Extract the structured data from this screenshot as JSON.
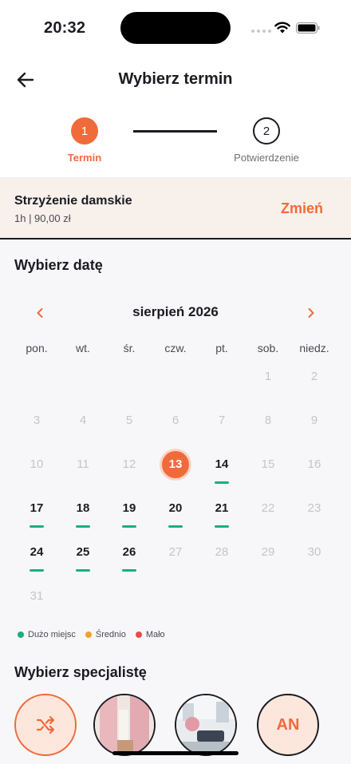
{
  "status": {
    "time": "20:32"
  },
  "header": {
    "title": "Wybierz termin"
  },
  "steps": [
    {
      "number": "1",
      "label": "Termin"
    },
    {
      "number": "2",
      "label": "Potwierdzenie"
    }
  ],
  "service": {
    "name": "Strzyżenie damskie",
    "meta": "1h | 90,00 zł",
    "change_label": "Zmień"
  },
  "date_section": {
    "title": "Wybierz datę"
  },
  "calendar": {
    "month": "sierpień 2026",
    "weekdays": [
      "pon.",
      "wt.",
      "śr.",
      "czw.",
      "pt.",
      "sob.",
      "niedz."
    ],
    "days": [
      {
        "n": "",
        "state": "empty"
      },
      {
        "n": "",
        "state": "empty"
      },
      {
        "n": "",
        "state": "empty"
      },
      {
        "n": "",
        "state": "empty"
      },
      {
        "n": "",
        "state": "empty"
      },
      {
        "n": "1",
        "state": "disabled"
      },
      {
        "n": "2",
        "state": "disabled"
      },
      {
        "n": "3",
        "state": "disabled"
      },
      {
        "n": "4",
        "state": "disabled"
      },
      {
        "n": "5",
        "state": "disabled"
      },
      {
        "n": "6",
        "state": "disabled"
      },
      {
        "n": "7",
        "state": "disabled"
      },
      {
        "n": "8",
        "state": "disabled"
      },
      {
        "n": "9",
        "state": "disabled"
      },
      {
        "n": "10",
        "state": "disabled"
      },
      {
        "n": "11",
        "state": "disabled"
      },
      {
        "n": "12",
        "state": "disabled"
      },
      {
        "n": "13",
        "state": "selected"
      },
      {
        "n": "14",
        "state": "available"
      },
      {
        "n": "15",
        "state": "disabled"
      },
      {
        "n": "16",
        "state": "disabled"
      },
      {
        "n": "17",
        "state": "available"
      },
      {
        "n": "18",
        "state": "available"
      },
      {
        "n": "19",
        "state": "available"
      },
      {
        "n": "20",
        "state": "available"
      },
      {
        "n": "21",
        "state": "available"
      },
      {
        "n": "22",
        "state": "disabled"
      },
      {
        "n": "23",
        "state": "disabled"
      },
      {
        "n": "24",
        "state": "available"
      },
      {
        "n": "25",
        "state": "available"
      },
      {
        "n": "26",
        "state": "available"
      },
      {
        "n": "27",
        "state": "disabled"
      },
      {
        "n": "28",
        "state": "disabled"
      },
      {
        "n": "29",
        "state": "disabled"
      },
      {
        "n": "30",
        "state": "disabled"
      },
      {
        "n": "31",
        "state": "disabled"
      }
    ]
  },
  "legend": [
    {
      "label": "Dużo miejsc",
      "color": "#1cae7d"
    },
    {
      "label": "Średnio",
      "color": "#f0a32a"
    },
    {
      "label": "Mało",
      "color": "#e94b4b"
    }
  ],
  "specialists_section": {
    "title": "Wybierz specjalistę"
  },
  "specialists": {
    "initials": "AN"
  },
  "colors": {
    "accent": "#f06b3b",
    "available": "#1cae7d"
  }
}
